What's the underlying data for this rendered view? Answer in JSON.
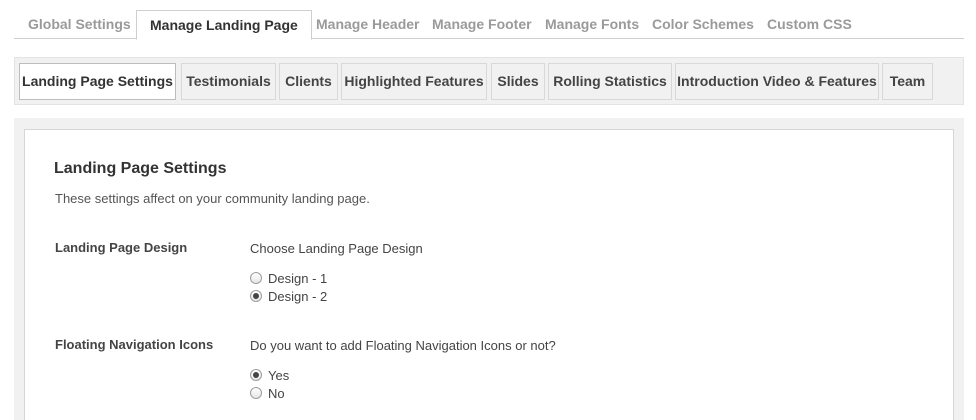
{
  "top_tabs": [
    {
      "label": "Global Settings",
      "active": false
    },
    {
      "label": "Manage Landing Page",
      "active": true
    },
    {
      "label": "Manage Header",
      "active": false
    },
    {
      "label": "Manage Footer",
      "active": false
    },
    {
      "label": "Manage Fonts",
      "active": false
    },
    {
      "label": "Color Schemes",
      "active": false
    },
    {
      "label": "Custom CSS",
      "active": false
    }
  ],
  "sub_tabs": [
    {
      "label": "Landing Page Settings",
      "active": true
    },
    {
      "label": "Testimonials",
      "active": false
    },
    {
      "label": "Clients",
      "active": false
    },
    {
      "label": "Highlighted Features",
      "active": false
    },
    {
      "label": "Slides",
      "active": false
    },
    {
      "label": "Rolling Statistics",
      "active": false
    },
    {
      "label": "Introduction Video & Features",
      "active": false
    },
    {
      "label": "Team",
      "active": false
    }
  ],
  "section": {
    "title": "Landing Page Settings",
    "description": "These settings affect on your community landing page."
  },
  "fields": {
    "design": {
      "label": "Landing Page Design",
      "question": "Choose Landing Page Design",
      "options": [
        {
          "label": "Design - 1",
          "checked": false
        },
        {
          "label": "Design - 2",
          "checked": true
        }
      ]
    },
    "floating_nav": {
      "label": "Floating Navigation Icons",
      "question": "Do you want to add Floating Navigation Icons or not?",
      "options": [
        {
          "label": "Yes",
          "checked": true
        },
        {
          "label": "No",
          "checked": false
        }
      ]
    }
  }
}
